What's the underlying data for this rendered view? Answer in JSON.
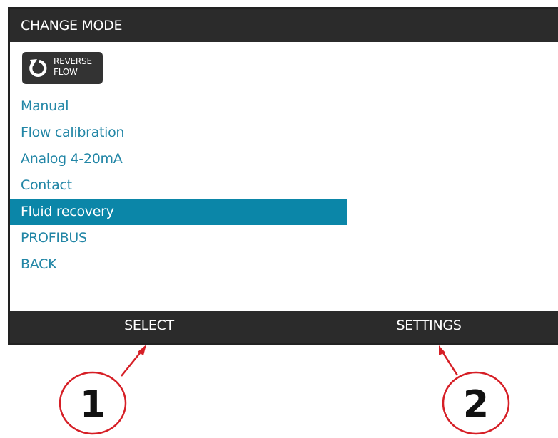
{
  "header": {
    "title": "CHANGE MODE"
  },
  "reverse_flow": {
    "line1": "REVERSE",
    "line2": "FLOW",
    "icon": "reverse-arrow-icon"
  },
  "menu": {
    "items": [
      {
        "label": "Manual",
        "selected": false
      },
      {
        "label": "Flow calibration",
        "selected": false
      },
      {
        "label": "Analog 4-20mA",
        "selected": false
      },
      {
        "label": "Contact",
        "selected": false
      },
      {
        "label": "Fluid recovery",
        "selected": true
      },
      {
        "label": "PROFIBUS",
        "selected": false
      },
      {
        "label": "BACK",
        "selected": false
      }
    ]
  },
  "softkeys": {
    "left": "SELECT",
    "right": "SETTINGS"
  },
  "callouts": {
    "one": "1",
    "two": "2"
  },
  "colors": {
    "bar": "#2b2b2b",
    "accent": "#0b86a8",
    "menu_text": "#2286a6",
    "callout": "#d61f26"
  }
}
